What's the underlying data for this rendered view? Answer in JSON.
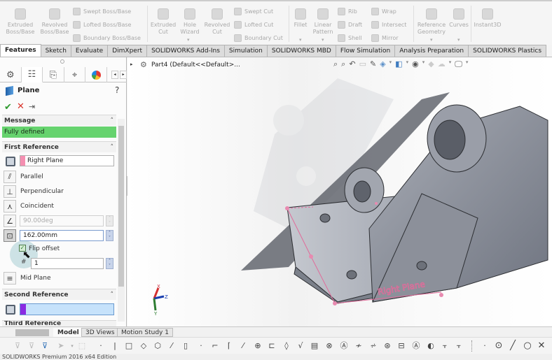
{
  "ribbon": {
    "boss_group": {
      "extruded": "Extruded\nBoss/Base",
      "revolved": "Revolved\nBoss/Base",
      "swept": "Swept Boss/Base",
      "lofted": "Lofted Boss/Base",
      "boundary": "Boundary Boss/Base"
    },
    "cut_group": {
      "extruded": "Extruded\nCut",
      "hole_wizard": "Hole\nWizard",
      "revolved": "Revolved\nCut",
      "swept": "Swept Cut",
      "lofted": "Lofted Cut",
      "boundary": "Boundary Cut"
    },
    "feature_group": {
      "fillet": "Fillet",
      "linear_pattern": "Linear\nPattern",
      "rib": "Rib",
      "draft": "Draft",
      "shell": "Shell",
      "wrap": "Wrap",
      "intersect": "Intersect",
      "mirror": "Mirror"
    },
    "ref_group": {
      "reference_geometry": "Reference\nGeometry",
      "curves": "Curves",
      "instant3d": "Instant3D"
    }
  },
  "command_tabs": [
    {
      "label": "Features",
      "active": true
    },
    {
      "label": "Sketch"
    },
    {
      "label": "Evaluate"
    },
    {
      "label": "DimXpert"
    },
    {
      "label": "SOLIDWORKS Add-Ins"
    },
    {
      "label": "Simulation"
    },
    {
      "label": "SOLIDWORKS MBD"
    },
    {
      "label": "Flow Simulation"
    },
    {
      "label": "Analysis Preparation"
    },
    {
      "label": "SOLIDWORKS Plastics"
    }
  ],
  "property_manager": {
    "title": "Plane",
    "help": "?",
    "message_section": "Message",
    "message_status": "Fully defined",
    "first_reference": {
      "heading": "First Reference",
      "selection": "Right Plane",
      "parallel": "Parallel",
      "perpendicular": "Perpendicular",
      "coincident": "Coincident",
      "angle": "90.00deg",
      "offset": "162.00mm",
      "flip_offset_label": "Flip offset",
      "flip_offset_checked": true,
      "instances": "1",
      "mid_plane": "Mid Plane"
    },
    "second_reference": {
      "heading": "Second Reference",
      "selection": ""
    },
    "third_reference_heading": "Third Reference"
  },
  "feature_tree": {
    "part_label": "Part4  (Default<<Default>..."
  },
  "viewport": {
    "plane_label": "Right Plane",
    "triad": {
      "x": "X",
      "y": "Y",
      "z": "Z"
    }
  },
  "bottom_tabs": [
    {
      "label": "Model",
      "active": true
    },
    {
      "label": "3D Views"
    },
    {
      "label": "Motion Study 1"
    }
  ],
  "status_bar": {
    "text": "SOLIDWORKS Premium 2016 x64 Edition"
  },
  "colors": {
    "fully_defined": "#66d36e",
    "first_ref_swatch": "#f48fb1",
    "second_ref_swatch": "#8a2be2",
    "second_ref_field": "#c6e2fb",
    "plane_preview": "#e06c9a"
  }
}
